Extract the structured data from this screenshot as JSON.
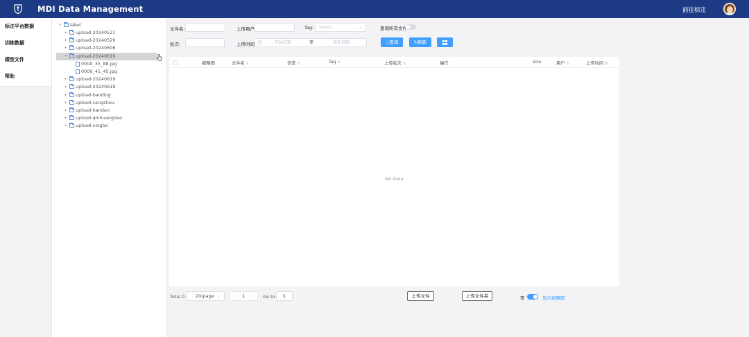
{
  "header": {
    "title": "MDI Data Management",
    "goto_label": "前往标注"
  },
  "sidebar": {
    "items": [
      {
        "label": "标注平台数据"
      },
      {
        "label": "训练数据"
      },
      {
        "label": "模型文件"
      },
      {
        "label": "帮助"
      }
    ]
  },
  "tree": {
    "nodes": [
      {
        "label": "label",
        "type": "folder",
        "expanded": true
      },
      {
        "label": "upload-20240521",
        "type": "folder"
      },
      {
        "label": "upload-20240529",
        "type": "folder"
      },
      {
        "label": "upload-20240606",
        "type": "folder"
      },
      {
        "label": "upload-20240619",
        "type": "folder",
        "expanded": true,
        "selected": true
      },
      {
        "label": "0000_35_88.jpg",
        "type": "file"
      },
      {
        "label": "0000_41_45.jpg",
        "type": "file"
      },
      {
        "label": "upload-20240619",
        "type": "folder"
      },
      {
        "label": "upload-20240619",
        "type": "folder"
      },
      {
        "label": "upload-baoding",
        "type": "folder"
      },
      {
        "label": "upload-cangzhou",
        "type": "folder"
      },
      {
        "label": "upload-handan",
        "type": "folder"
      },
      {
        "label": "upload-qinhuangdao",
        "type": "folder"
      },
      {
        "label": "upload-xingtai",
        "type": "folder"
      }
    ]
  },
  "filters": {
    "filename_label": "文件名:",
    "filename_value": "",
    "uploader_label": "上传用户:",
    "uploader_value": "",
    "tag_label": "Tag:",
    "tag_placeholder": "Select",
    "all_files_label": "查询所有文件:",
    "all_files_on": false,
    "batch_label": "批次:",
    "batch_value": "",
    "upload_time_label": "上传时间:",
    "start_date_placeholder": "开始日期",
    "date_separator": "至",
    "end_date_placeholder": "结束日期",
    "query_label": "查询",
    "refresh_label": "刷新"
  },
  "table": {
    "columns": [
      {
        "label": "缩略图",
        "sortable": false
      },
      {
        "label": "文件名",
        "sortable": true
      },
      {
        "label": "倍率",
        "sortable": true
      },
      {
        "label": "Tag",
        "sortable": true
      },
      {
        "label": "上传批次",
        "sortable": true
      },
      {
        "label": "操作",
        "sortable": false
      },
      {
        "label": "size",
        "sortable": false
      },
      {
        "label": "用户",
        "sortable": true
      },
      {
        "label": "上传时间",
        "sortable": true,
        "sort_active": true
      }
    ],
    "rows": [],
    "empty_text": "No Data"
  },
  "pagination": {
    "total_label": "Total 0",
    "page_size": "20/page",
    "current_page": "1",
    "goto_label": "Go to",
    "goto_value": "1"
  },
  "actions": {
    "upload_file_label": "上传文件",
    "upload_folder_label": "上传文件夹",
    "thumbnail_off_label": "否",
    "thumbnail_on_label": "显示缩略图",
    "thumbnail_on": true
  },
  "colors": {
    "header_bg": "#1d3a84",
    "accent": "#409eff",
    "page_bg": "#f3f3f5"
  }
}
